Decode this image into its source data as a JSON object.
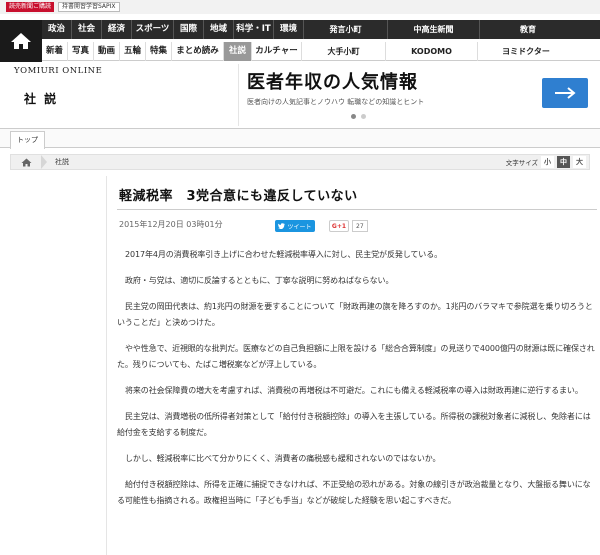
{
  "promo": {
    "left_label": "読売新聞ご購読",
    "right_label": "持書開習学習SAPIX"
  },
  "nav": {
    "row1": [
      "政治",
      "社会",
      "経済",
      "スポーツ",
      "国際",
      "地域",
      "科学・IT",
      "環境",
      "発言小町",
      "中高生新聞",
      "教育"
    ],
    "row2": [
      "新着",
      "写真",
      "動画",
      "五輪",
      "特集",
      "まとめ読み",
      "社説",
      "カルチャー",
      "大手小町",
      "KODOMO",
      "ヨミドクター"
    ],
    "active": "社説"
  },
  "header": {
    "logo": "YOMIURI ONLINE",
    "section_title": "社 説"
  },
  "ad": {
    "title": "医者年収の人気情報",
    "subtitle": "医者向けの人気記事とノウハウ 転職などの知識とヒント"
  },
  "topbar": {
    "tab": "トップ"
  },
  "breadcrumb": {
    "label": "社説"
  },
  "font_size": {
    "label": "文字サイズ",
    "small": "小",
    "medium": "中",
    "large": "大"
  },
  "article": {
    "title": "軽減税率　3党合意にも違反していない",
    "date": "2015年12月20日 03時01分",
    "tweet_label": "ツイート",
    "gplus_label": "G+1",
    "gplus_count": "27",
    "paragraphs": [
      "2017年4月の消費税率引き上げに合わせた軽減税率導入に対し、民主党が反発している。",
      "政府・与党は、適切に反論するとともに、丁寧な説明に努めねばならない。",
      "民主党の岡田代表は、約1兆円の財源を要することについて「財政再建の旗を降ろすのか。1兆円のバラマキで参院選を乗り切ろうということだ」と決めつけた。",
      "やや性急で、近視眼的な批判だ。医療などの自己負担額に上限を設ける「総合合算制度」の見送りで4000億円の財源は既に確保された。残りについても、たばこ増税案などが浮上している。",
      "将来の社会保障費の増大を考慮すれば、消費税の再増税は不可避だ。これにも備える軽減税率の導入は財政再建に逆行するまい。",
      "民主党は、消費増税の低所得者対策として「給付付き税額控除」の導入を主張している。所得税の課税対象者に減税し、免除者には給付金を支給する制度だ。",
      "しかし、軽減税率に比べて分かりにくく、消費者の痛税感も緩和されないのではないか。",
      "給付付き税額控除は、所得を正確に捕捉できなければ、不正受給の恐れがある。対象の線引きが政治裁量となり、大盤振る舞いになる可能性も指摘される。政権担当時に「子ども手当」などが破綻した経験を思い起こすべきだ。"
    ]
  },
  "colors": {
    "accent": "#c8102e",
    "nav_dark": "#2b2b2b",
    "ad_button": "#2f7fd0",
    "tweet": "#1b95e0"
  }
}
